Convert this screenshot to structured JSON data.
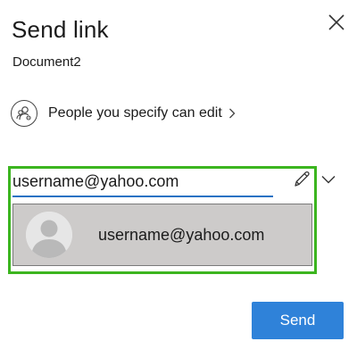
{
  "header": {
    "title": "Send link",
    "subtitle": "Document2"
  },
  "close": {
    "icon": "close-icon"
  },
  "permissions": {
    "icon": "people-settings-icon",
    "label": "People you specify can edit",
    "chevron_icon": "chevron-right-icon"
  },
  "recipient": {
    "value": "username@yahoo.com",
    "edit_icon": "pencil-icon",
    "dropdown_icon": "chevron-down-icon"
  },
  "suggestion": {
    "avatar_icon": "person-placeholder-icon",
    "email": "username@yahoo.com"
  },
  "actions": {
    "send_label": "Send"
  },
  "colors": {
    "accent": "#2f82d9",
    "highlight_border": "#3cb51f",
    "suggestion_bg": "#cdcbca",
    "input_underline": "#2672c4"
  }
}
